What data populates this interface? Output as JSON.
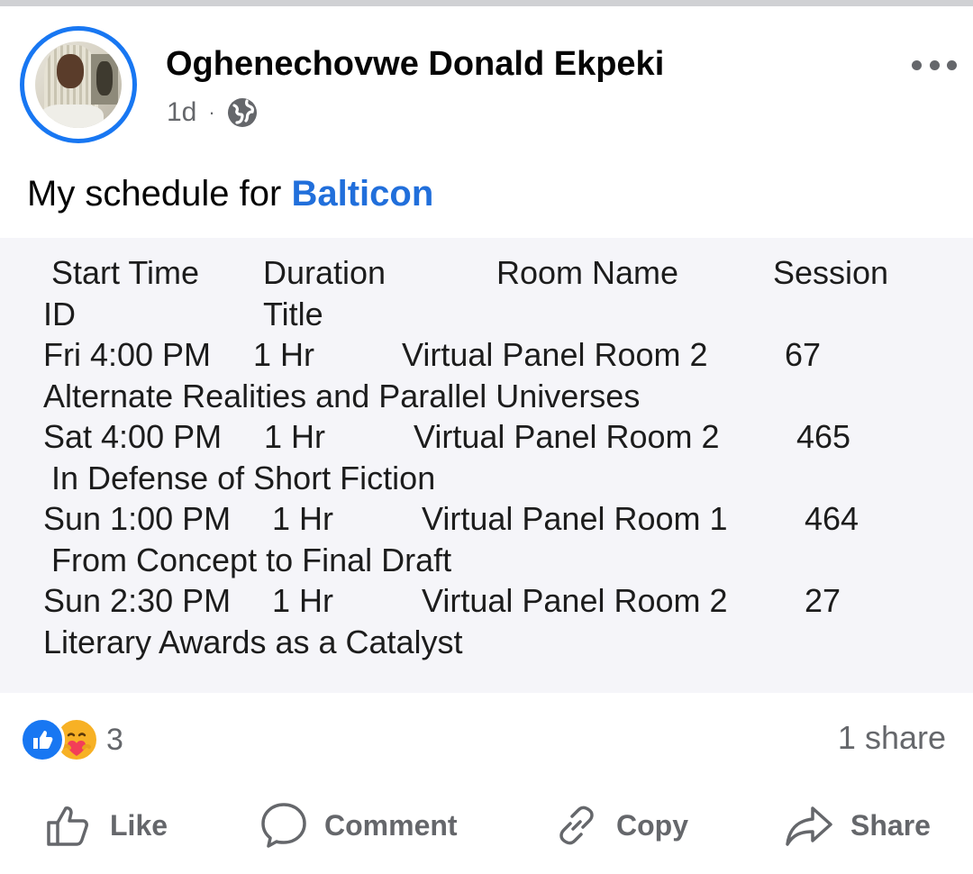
{
  "post": {
    "author": "Oghenechovwe Donald Ekpeki",
    "time": "1d",
    "dot": "·",
    "audience_icon": "globe-icon",
    "more_icon": "more-dots-icon",
    "text_prefix": "My schedule for ",
    "text_link": "Balticon"
  },
  "schedule": {
    "header": {
      "start_time": "Start Time",
      "duration": "Duration",
      "room_name": "Room Name",
      "session": "Session",
      "id": "ID",
      "title": "Title"
    },
    "rows": [
      {
        "start": "Fri 4:00 PM",
        "duration": "1 Hr",
        "room": "Virtual Panel Room 2",
        "id": "67",
        "title": "Alternate Realities and Parallel Universes"
      },
      {
        "start": "Sat 4:00 PM",
        "duration": "1 Hr",
        "room": "Virtual Panel Room 2",
        "id": "465",
        "title": "In Defense of Short Fiction"
      },
      {
        "start": "Sun 1:00 PM",
        "duration": "1 Hr",
        "room": "Virtual Panel Room 1",
        "id": "464",
        "title": "From Concept to Final Draft"
      },
      {
        "start": "Sun 2:30 PM",
        "duration": "1 Hr",
        "room": "Virtual Panel Room 2",
        "id": "27",
        "title": "Literary Awards as a Catalyst"
      }
    ]
  },
  "engagement": {
    "reaction_icons": [
      "like-reaction-icon",
      "care-reaction-icon"
    ],
    "reaction_count": "3",
    "shares": "1 share"
  },
  "actions": {
    "like": "Like",
    "comment": "Comment",
    "copy": "Copy",
    "share": "Share"
  },
  "colors": {
    "brand_blue": "#1877f2",
    "link_blue": "#216fdb",
    "muted": "#65676b",
    "care_yellow": "#f7b125"
  }
}
